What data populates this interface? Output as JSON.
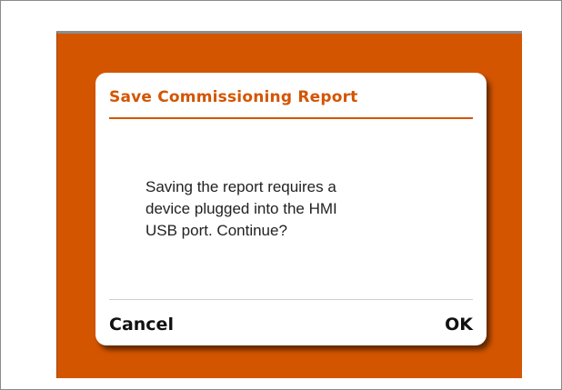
{
  "dialog": {
    "title": "Save Commissioning Report",
    "message_lines": [
      "Saving the report requires a",
      "device plugged into the HMI",
      "USB port.  Continue?"
    ],
    "cancel_label": "Cancel",
    "ok_label": "OK"
  },
  "colors": {
    "accent": "#d45500",
    "dialog_background": "#ffffff",
    "divider": "#cfcfcf"
  }
}
